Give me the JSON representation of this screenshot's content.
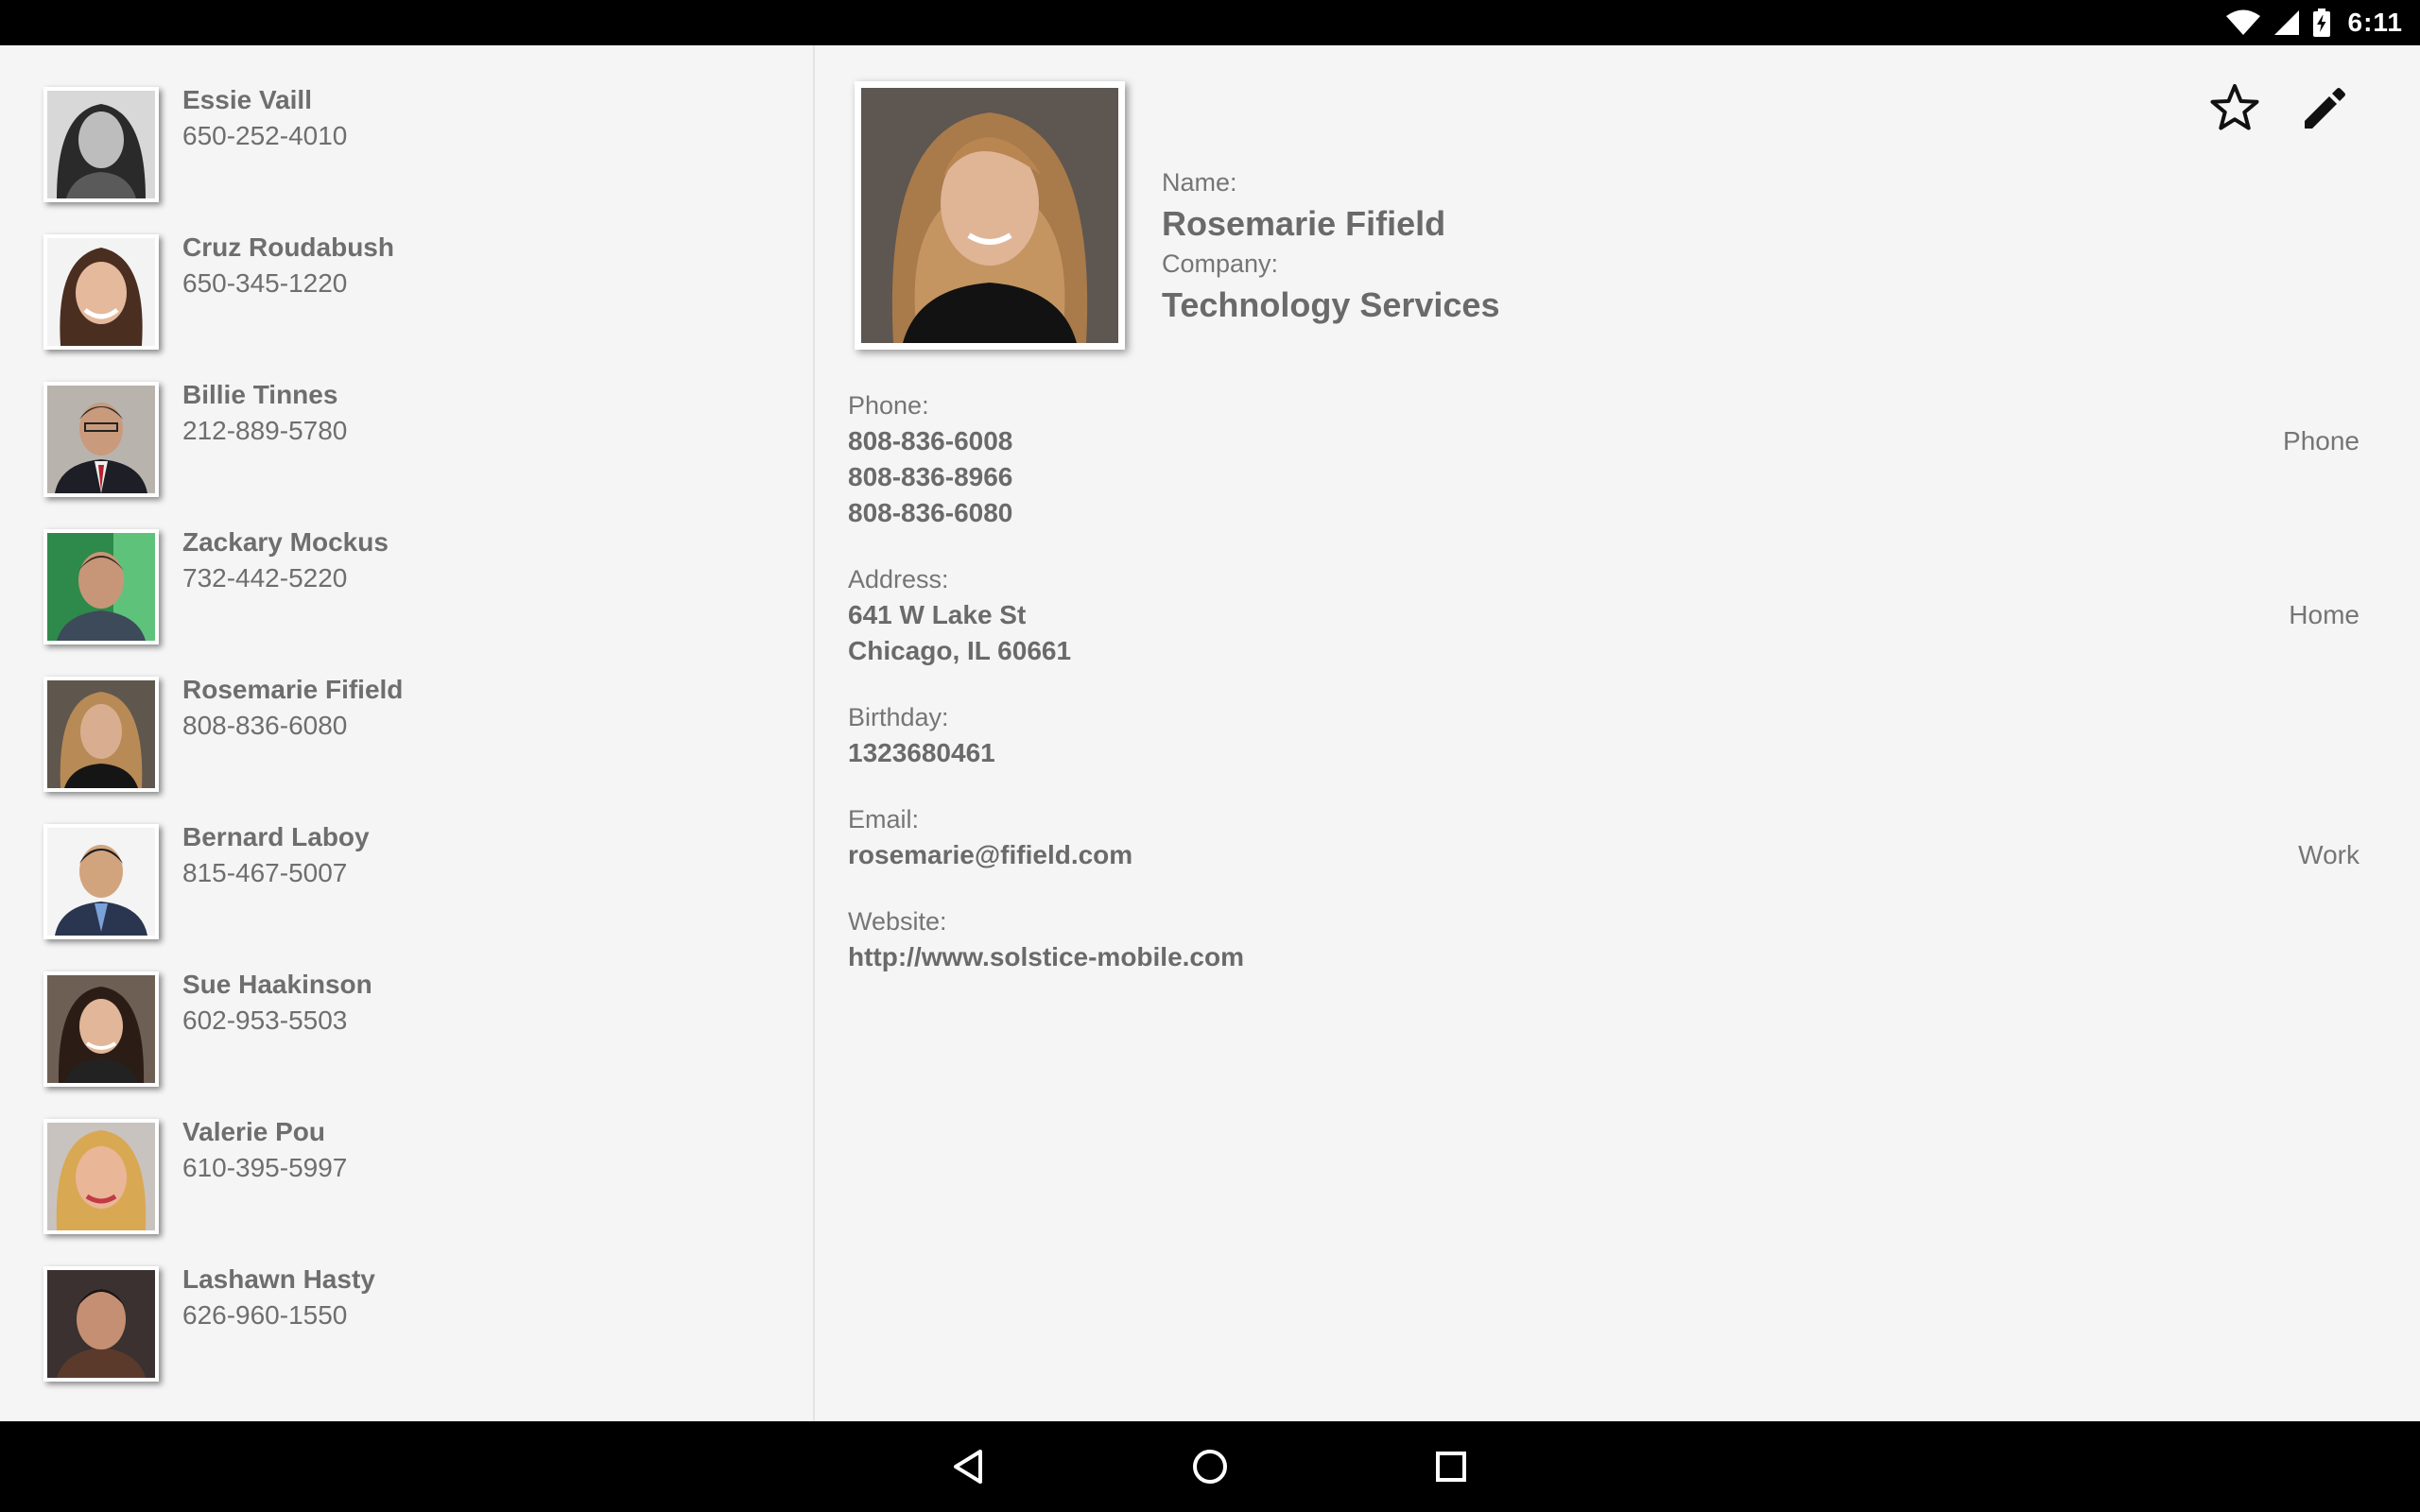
{
  "status_bar": {
    "time": "6:11",
    "icons": [
      "wifi-icon",
      "signal-icon",
      "battery-charging-icon"
    ]
  },
  "contacts": [
    {
      "name": "Essie Vaill",
      "phone": "650-252-4010"
    },
    {
      "name": "Cruz Roudabush",
      "phone": "650-345-1220"
    },
    {
      "name": "Billie Tinnes",
      "phone": "212-889-5780"
    },
    {
      "name": "Zackary Mockus",
      "phone": "732-442-5220"
    },
    {
      "name": "Rosemarie Fifield",
      "phone": "808-836-6080"
    },
    {
      "name": "Bernard Laboy",
      "phone": "815-467-5007"
    },
    {
      "name": "Sue Haakinson",
      "phone": "602-953-5503"
    },
    {
      "name": "Valerie Pou",
      "phone": "610-395-5997"
    },
    {
      "name": "Lashawn Hasty",
      "phone": "626-960-1550"
    }
  ],
  "detail": {
    "name_label": "Name:",
    "name": "Rosemarie Fifield",
    "company_label": "Company:",
    "company": "Technology Services",
    "phone_label": "Phone:",
    "phones": [
      "808-836-6008",
      "808-836-8966",
      "808-836-6080"
    ],
    "phone_type": "Phone",
    "address_label": "Address:",
    "address_line1": "641 W Lake St",
    "address_line2": "Chicago, IL 60661",
    "address_type": "Home",
    "birthday_label": "Birthday:",
    "birthday": "1323680461",
    "email_label": "Email:",
    "email": "rosemarie@fifield.com",
    "email_type": "Work",
    "website_label": "Website:",
    "website": "http://www.solstice-mobile.com",
    "actions": [
      "star-icon",
      "edit-pencil-icon"
    ]
  },
  "nav_bar": {
    "buttons": [
      "back-icon",
      "home-icon",
      "recents-icon"
    ]
  },
  "colors": {
    "background": "#f5f5f5",
    "text": "#6a6a6a",
    "bars": "#000000"
  }
}
